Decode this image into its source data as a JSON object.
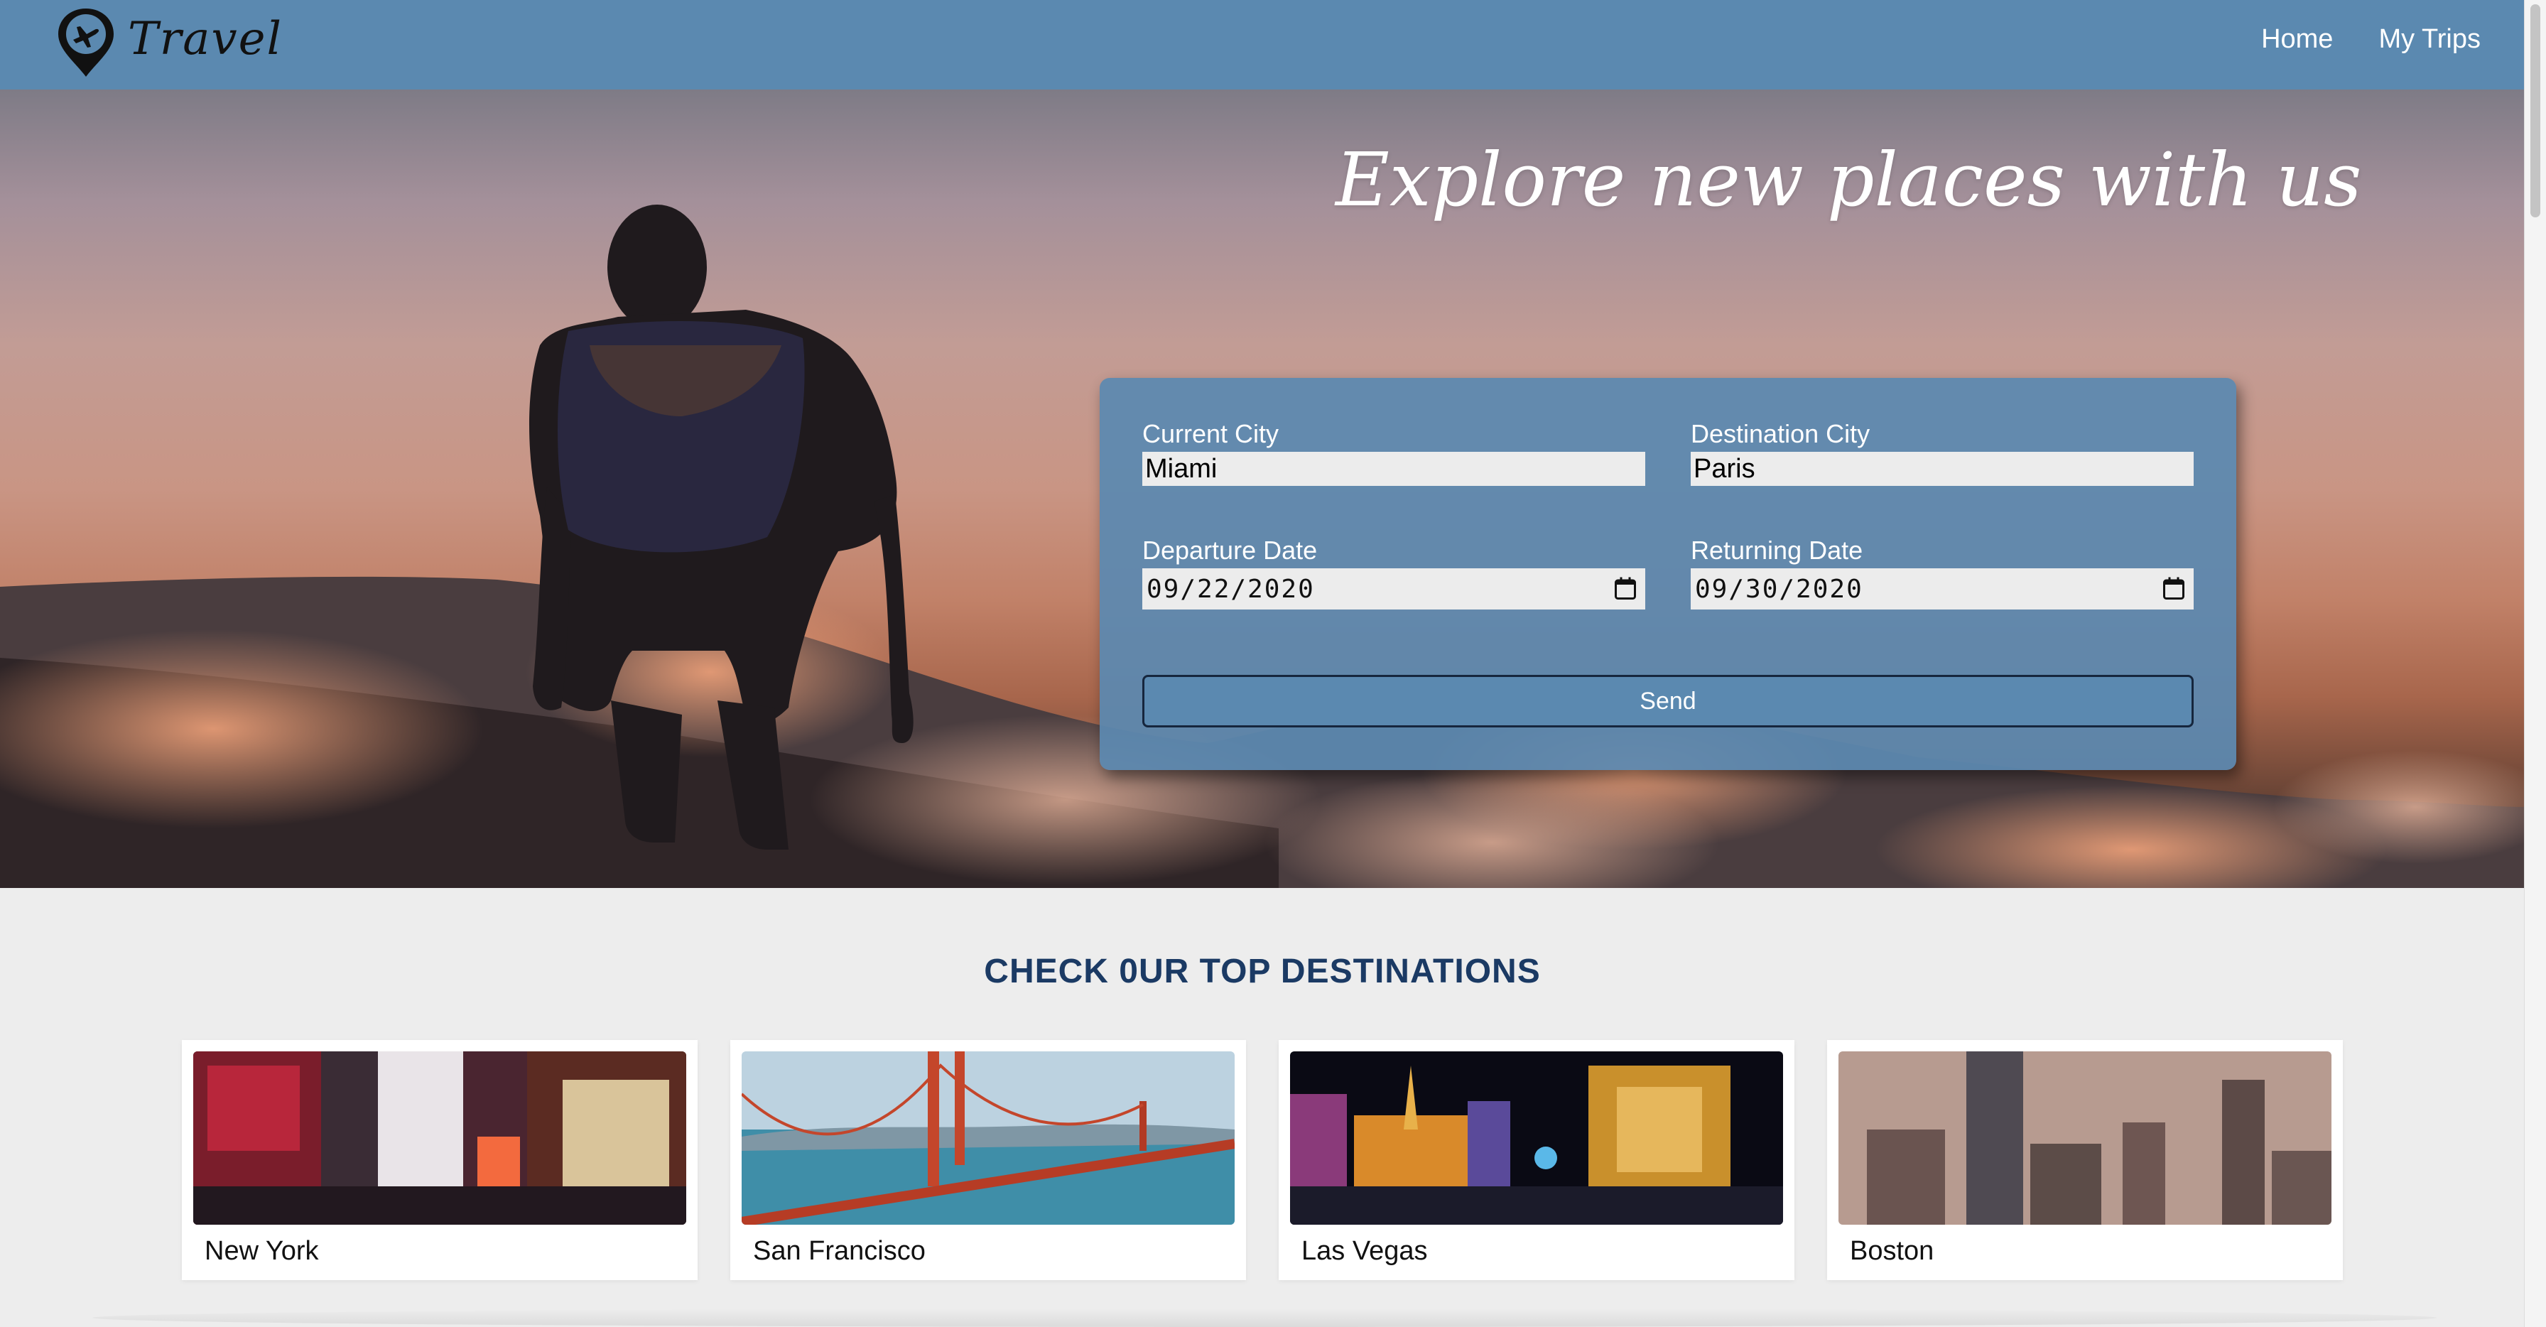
{
  "header": {
    "brand": "Travel",
    "logo_icon": "plane-pin-icon",
    "nav": [
      {
        "label": "Home"
      },
      {
        "label": "My Trips"
      }
    ]
  },
  "hero": {
    "title": "Explore new places with us"
  },
  "form": {
    "current_city": {
      "label": "Current City",
      "value": "Miami"
    },
    "destination_city": {
      "label": "Destination City",
      "value": "Paris"
    },
    "departure_date": {
      "label": "Departure Date",
      "value": "09/22/2020"
    },
    "returning_date": {
      "label": "Returning Date",
      "value": "09/30/2020"
    },
    "submit_label": "Send",
    "calendar_icon": "calendar-icon"
  },
  "destinations": {
    "heading": "CHECK 0UR TOP DESTINATIONS",
    "items": [
      {
        "name": "New York"
      },
      {
        "name": "San Francisco"
      },
      {
        "name": "Las Vegas"
      },
      {
        "name": "Boston"
      }
    ]
  },
  "colors": {
    "nav": "#5b89b0",
    "heading": "#1b3a64",
    "page_bg": "#ededed"
  }
}
